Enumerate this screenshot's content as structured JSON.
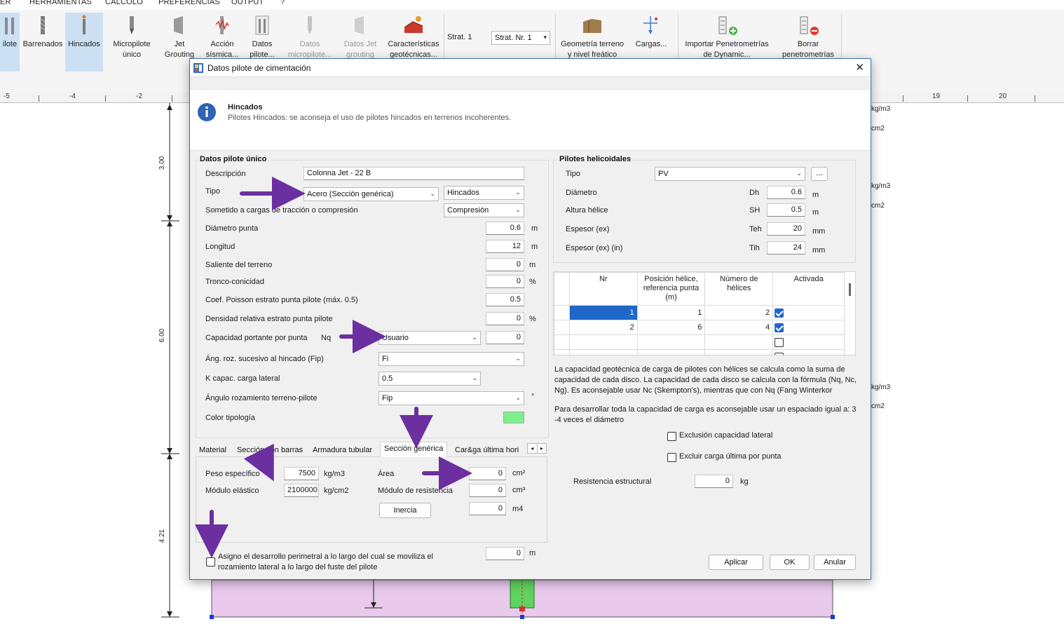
{
  "menu": [
    "ER",
    "HERRAMIENTAS",
    "CALCOLO",
    "PREFERENCIAS",
    "OUTPUT",
    "?"
  ],
  "ribbon": {
    "items": [
      {
        "label1": "ilote",
        "label2": ""
      },
      {
        "label1": "Barrenados",
        "label2": ""
      },
      {
        "label1": "Hincados",
        "label2": ""
      },
      {
        "label1": "Micropilote",
        "label2": "único"
      },
      {
        "label1": "Jet",
        "label2": "Grouting"
      },
      {
        "label1": "Acción",
        "label2": "sísmica..."
      },
      {
        "label1": "Datos",
        "label2": "pilote..."
      },
      {
        "label1": "Datos",
        "label2": "micropilote..."
      },
      {
        "label1": "Datos Jet",
        "label2": "grouting"
      },
      {
        "label1": "Características",
        "label2": "geotécnicas..."
      },
      {
        "label1": "Geometría terreno",
        "label2": "y nivel freático"
      },
      {
        "label1": "Cargas...",
        "label2": ""
      },
      {
        "label1": "Importar Penetrometrías",
        "label2": "de Dynamic..."
      },
      {
        "label1": "Borrar",
        "label2": "penetrometrías"
      }
    ],
    "strat_label": "Strat. 1",
    "strat_select": "Strat. Nr. 1"
  },
  "ruler": [
    "-5",
    "-4",
    "-2",
    "19",
    "20"
  ],
  "canvas": {
    "dims": [
      "3.00",
      "6.00",
      "4.21"
    ],
    "right_labels": [
      "kg/m3",
      "cm2",
      "kg/m3",
      "cm2",
      "kg/m3",
      "cm2"
    ]
  },
  "dialog": {
    "title": "Datos pilote de cimentación",
    "info_title": "Hincados",
    "info_text": "Pilotes Hincados: se aconseja el uso de pilotes hincados en terrenos incoherentes.",
    "left": {
      "group_title": "Datos pilote único",
      "descripcion_label": "Descripción",
      "descripcion": "Colonna Jet - 22 B",
      "tipo_label": "Tipo",
      "tipo": "Acero (Sección genérica)",
      "tipo2": "Hincados",
      "sometido_label": "Sometido a cargas de tracción o compresión",
      "sometido": "Compresión",
      "diam_label": "Diámetro punta",
      "diam": "0.6",
      "diam_u": "m",
      "long_label": "Longitud",
      "long": "12",
      "long_u": "m",
      "saliente_label": "Saliente del terreno",
      "saliente": "0",
      "saliente_u": "m",
      "tronco_label": "Tronco-conicidad",
      "tronco": "0",
      "tronco_u": "%",
      "poisson_label": "Coef. Poisson estrato punta pilote (máx. 0.5)",
      "poisson": "0.5",
      "dens_label": "Densidad relativa estrato punta pilote",
      "dens": "0",
      "dens_u": "%",
      "cap_label": "Capacidad portante por punta",
      "cap_nq": "Nq",
      "cap_sel": "Usuario",
      "cap_val": "0",
      "ang_hinc_label": "Áng. roz. sucesivo al hincado (Fip)",
      "ang_hinc": "Fi",
      "kcap_label": "K capac. carga lateral",
      "kcap": "0.5",
      "ang_roz_label": "Ángulo rozamiento terreno-pilote",
      "ang_roz": "Fip",
      "ang_roz_u": "°",
      "color_label": "Color tipología",
      "color": "#7ef08a",
      "tabs": [
        "Material",
        "Sección con barras",
        "Armadura tubular",
        "Sección genérica",
        "Car&ga última hori"
      ],
      "peso_label": "Peso específico",
      "peso": "7500",
      "peso_u": "kg/m3",
      "modulo_label": "Módulo elástico",
      "modulo": "2100000",
      "modulo_u": "kg/cm2",
      "area_label": "Área",
      "area": "0",
      "area_u": "cm²",
      "modres_label": "Módulo de resistencia",
      "modres": "0",
      "modres_u": "cm³",
      "inercia_btn": "Inercia",
      "inercia": "0",
      "inercia_u": "m4",
      "perim_text1": "Asigno el desarrollo perimetral a lo largo del cual se moviliza el",
      "perim_text2": "rozamiento lateral a lo largo del fuste del pilote",
      "perim": "0",
      "perim_u": "m"
    },
    "right": {
      "group_title": "Pilotes helicoidales",
      "tipo_label": "Tipo",
      "tipo": "PV",
      "more": "...",
      "dh_label": "Diámetro",
      "dh_sym": "Dh",
      "dh": "0.6",
      "dh_u": "m",
      "sh_label": "Altura hélice",
      "sh_sym": "SH",
      "sh": "0.5",
      "sh_u": "m",
      "teh_label": "Espesor (ex)",
      "teh_sym": "Teh",
      "teh": "20",
      "teh_u": "mm",
      "tih_label": "Espesor (ex) (in)",
      "tih_sym": "Tih",
      "tih": "24",
      "tih_u": "mm",
      "table_headers": [
        "Nr",
        "Posición hélice, referencia punta (m)",
        "Número de hélices",
        "Activada"
      ],
      "rows": [
        {
          "nr": "1",
          "pos": "1",
          "num": "2",
          "on": true
        },
        {
          "nr": "2",
          "pos": "6",
          "num": "4",
          "on": true
        }
      ],
      "note1": "La capacidad geotécnica de carga de pilotes con hélices se calcula como la suma de capacidad de cada disco. La capacidad de cada disco se calcula con la fórmula (Nq, Nc, Ng). Es aconsejable usar Nc (Skempton's), mientras que con Nq (Fang  Winterkor",
      "note2": "Para desarrollar toda la capacidad de carga es aconsejable usar un espaciado igual a: 3 -4 veces el diámetro",
      "excl_lat": "Exclusión capacidad lateral",
      "excl_punta": "Excluir carga última por punta",
      "res_label": "Resistencia estructural",
      "res": "0",
      "res_u": "kg"
    },
    "buttons": {
      "aplicar": "Aplicar",
      "ok": "OK",
      "anular": "Anular"
    }
  },
  "colors": {
    "accent": "#1f67c9",
    "arrow": "#6b2fa0",
    "pile_fill": "#e9c9ec",
    "green": "#7ef08a"
  }
}
